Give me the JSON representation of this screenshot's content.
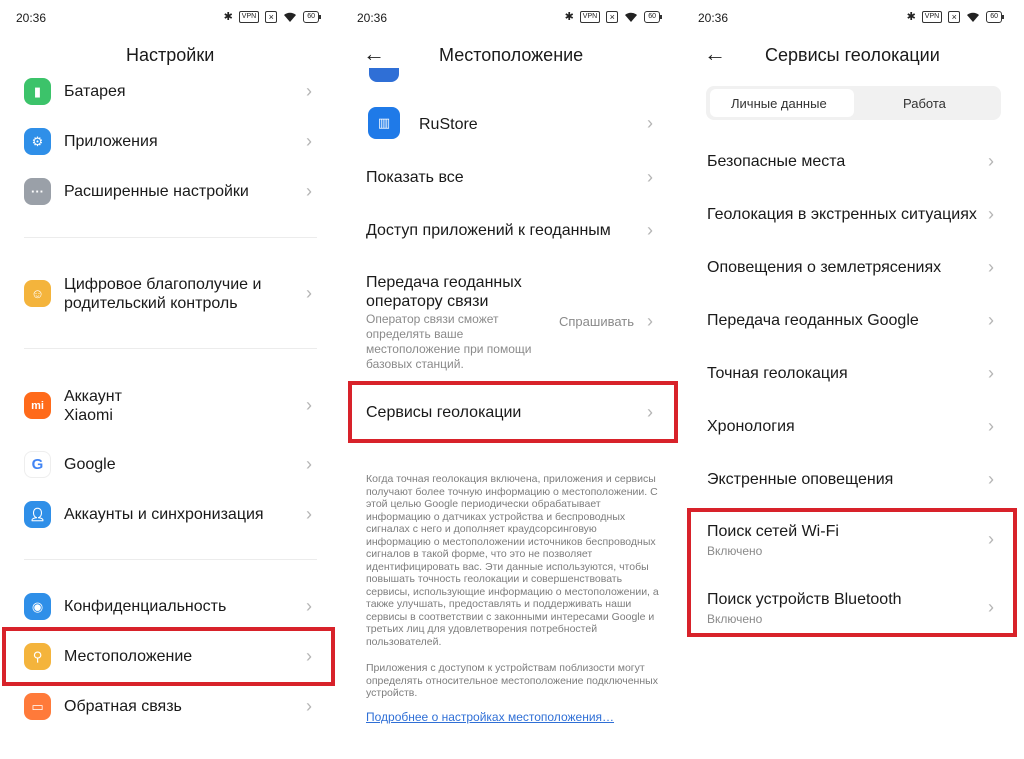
{
  "status": {
    "time": "20:36",
    "vpn": "VPN",
    "battery": "60"
  },
  "p1": {
    "title": "Настройки",
    "items": [
      {
        "label": "Батарея"
      },
      {
        "label": "Приложения"
      },
      {
        "label": "Расширенные настройки"
      },
      {
        "label": "Цифровое благополучие и родительский контроль"
      },
      {
        "label": "Аккаунт Xiaomi"
      },
      {
        "label": "Google"
      },
      {
        "label": "Аккаунты и синхронизация"
      },
      {
        "label": "Конфиденциальность"
      },
      {
        "label": "Местоположение"
      },
      {
        "label": "Обратная связь"
      }
    ]
  },
  "p2": {
    "title": "Местоположение",
    "rustore": "RuStore",
    "show_all": "Показать все",
    "app_access": "Доступ приложений к геоданным",
    "carrier_title": "Передача геоданных оператору связи",
    "carrier_sub": "Оператор связи сможет определять ваше местоположение при помощи базовых станций.",
    "carrier_value": "Спрашивать",
    "geo_services": "Сервисы геолокации",
    "desc1": "Когда точная геолокация включена, приложения и сервисы получают более точную информацию о местоположении. С этой целью Google периодически обрабатывает информацию о датчиках устройства и беспроводных сигналах с него и дополняет краудсорсинговую информацию о местоположении источников беспроводных сигналов в такой форме, что это не позволяет идентифицировать вас. Эти данные используются, чтобы повышать точность геолокации и совершенствовать сервисы, использующие информацию о местоположении, а также улучшать, предоставлять и поддерживать наши сервисы в соответствии с законными интересами Google и третьих лиц для удовлетворения потребностей пользователей.",
    "desc2": "Приложения с доступом к устройствам поблизости могут определять относительное местоположение подключенных устройств.",
    "link": "Подробнее о настройках местоположения…"
  },
  "p3": {
    "title": "Сервисы геолокации",
    "tabs": [
      "Личные данные",
      "Работа"
    ],
    "items": [
      {
        "label": "Безопасные места"
      },
      {
        "label": "Геолокация в экстренных ситуациях"
      },
      {
        "label": "Оповещения о землетрясениях"
      },
      {
        "label": "Передача геоданных Google"
      },
      {
        "label": "Точная геолокация"
      },
      {
        "label": "Хронология"
      },
      {
        "label": "Экстренные оповещения"
      },
      {
        "label": "Поиск сетей Wi-Fi",
        "sub": "Включено"
      },
      {
        "label": "Поиск устройств Bluetooth",
        "sub": "Включено"
      }
    ]
  },
  "colors": {
    "highlight": "#d8222a",
    "link": "#2f6fd6"
  }
}
